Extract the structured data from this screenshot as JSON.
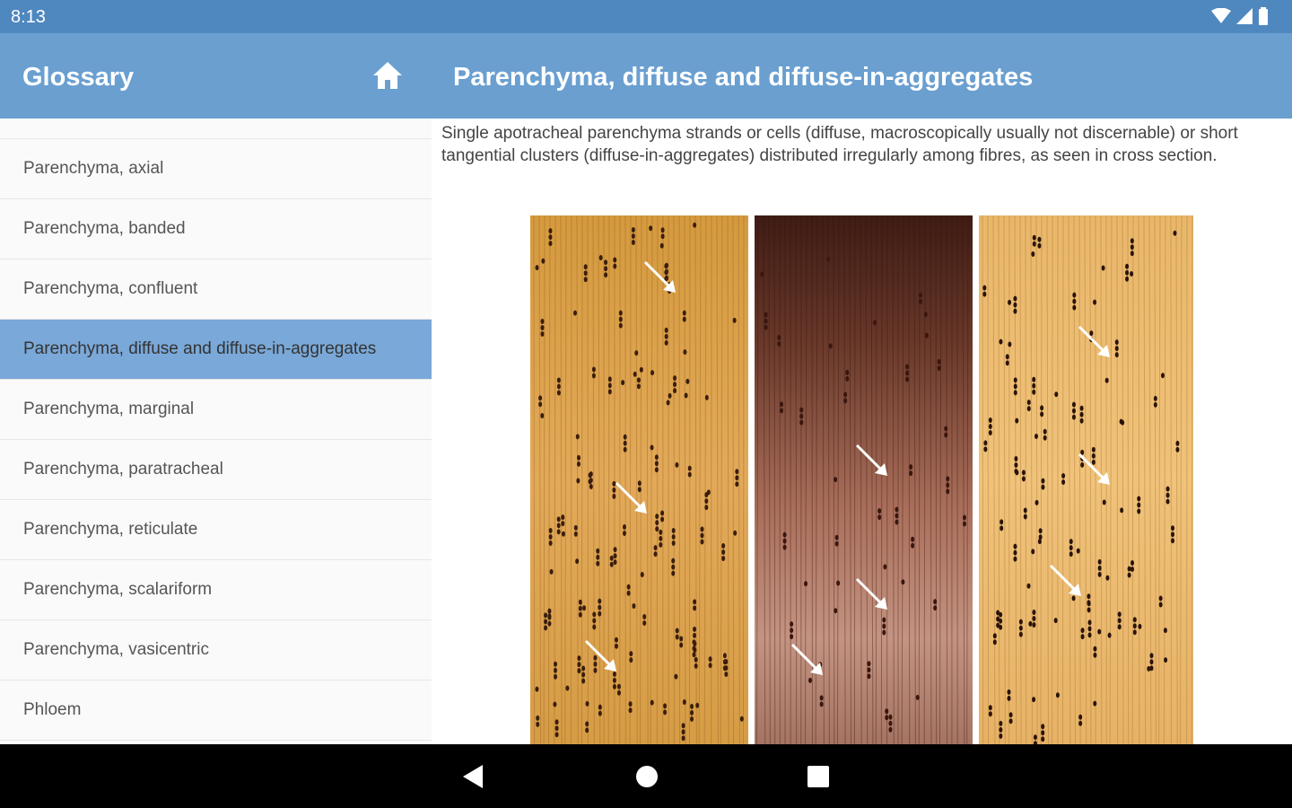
{
  "status_bar": {
    "time": "8:13"
  },
  "app_bar": {
    "title": "Glossary",
    "detail_title": "Parenchyma, diffuse and diffuse-in-aggregates"
  },
  "sidebar": {
    "items": [
      {
        "label": "Parenchyma, axial",
        "selected": false
      },
      {
        "label": "Parenchyma, banded",
        "selected": false
      },
      {
        "label": "Parenchyma, confluent",
        "selected": false
      },
      {
        "label": "Parenchyma, diffuse and diffuse-in-aggregates",
        "selected": true
      },
      {
        "label": "Parenchyma, marginal",
        "selected": false
      },
      {
        "label": "Parenchyma, paratracheal",
        "selected": false
      },
      {
        "label": "Parenchyma, reticulate",
        "selected": false
      },
      {
        "label": "Parenchyma, scalariform",
        "selected": false
      },
      {
        "label": "Parenchyma, vasicentric",
        "selected": false
      },
      {
        "label": "Phloem",
        "selected": false
      }
    ]
  },
  "content": {
    "description": "Single apotracheal parenchyma strands or cells (diffuse, macroscopically usually not discernable) or short tangential clusters (diffuse-in-aggregates) distributed irregularly among fibres, as seen in cross section."
  },
  "colors": {
    "status_bar": "#4f87bf",
    "app_bar": "#6a9fd0",
    "selected_item": "#7aa8d8"
  },
  "icons": {
    "home": "home-icon",
    "wifi": "wifi-icon",
    "signal": "signal-icon",
    "battery": "battery-icon",
    "back": "back-icon",
    "home_nav": "home-nav-icon",
    "recents": "recents-icon"
  }
}
